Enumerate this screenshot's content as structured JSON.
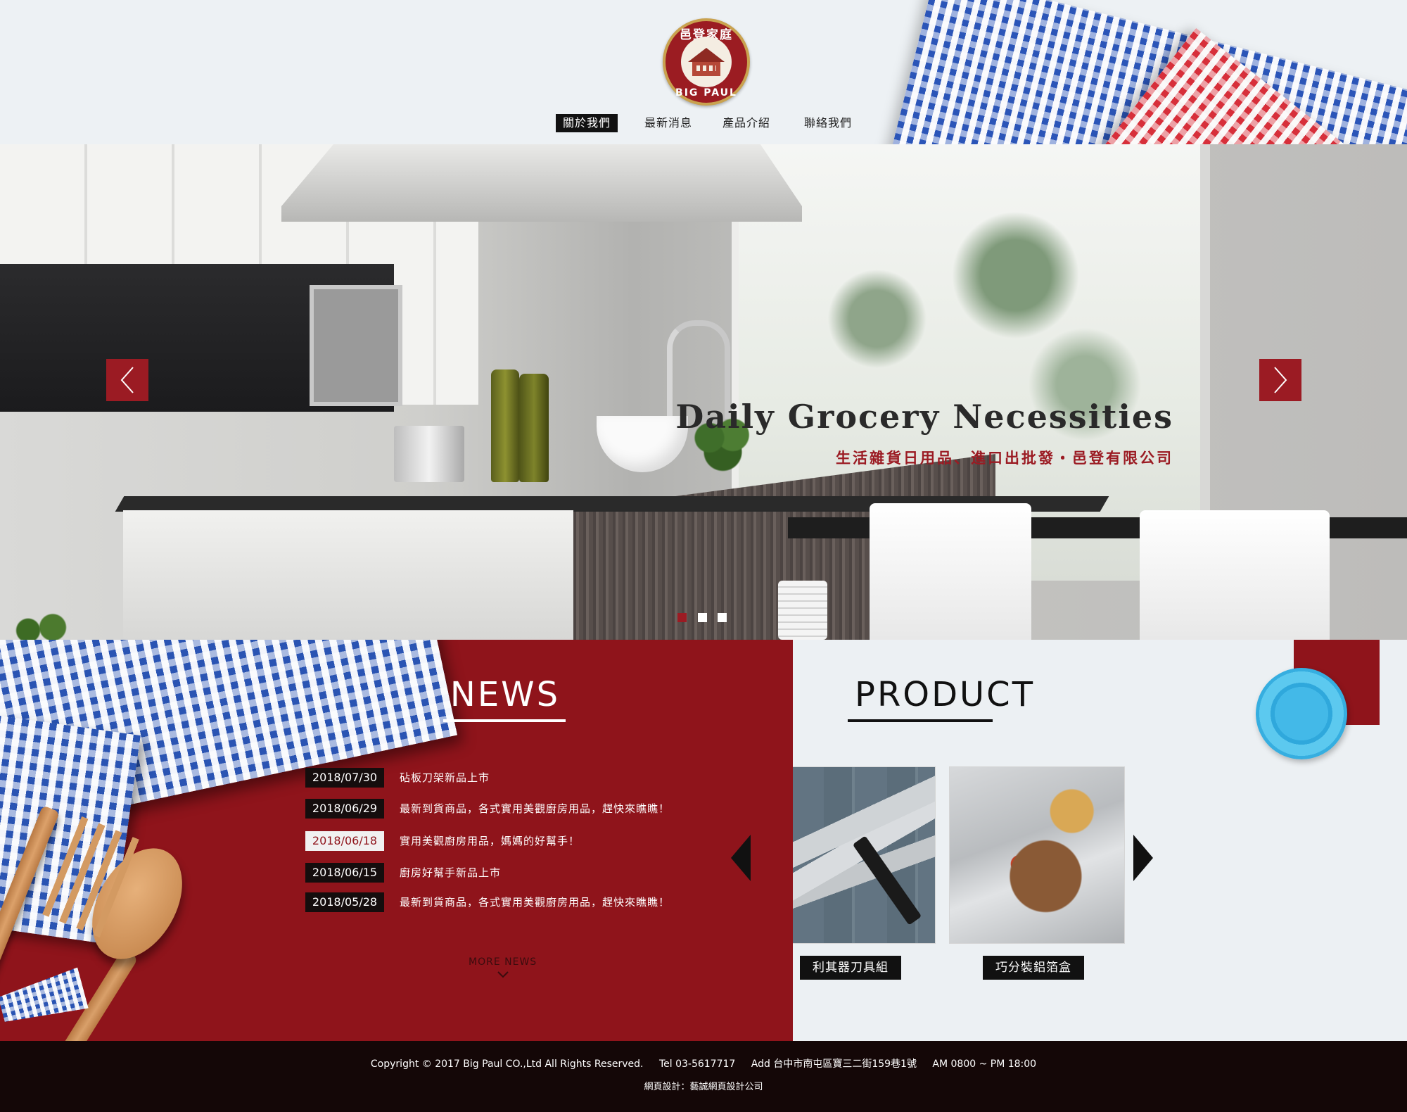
{
  "logo": {
    "cn": "邑登家庭",
    "en": "BIG PAUL"
  },
  "nav": {
    "items": [
      {
        "label": "關於我們",
        "active": true
      },
      {
        "label": "最新消息",
        "active": false
      },
      {
        "label": "產品介紹",
        "active": false
      },
      {
        "label": "聯絡我們",
        "active": false
      }
    ]
  },
  "hero": {
    "title": "Daily Grocery Necessities",
    "subtitle": "生活雜貨日用品、進口出批發・邑登有限公司",
    "arrow_left_icon": "chevron-left-icon",
    "arrow_right_icon": "chevron-right-icon",
    "slides_total": 3,
    "active_slide": 1
  },
  "news": {
    "title": "NEWS",
    "items": [
      {
        "date": "2018/07/30",
        "text": "砧板刀架新品上市",
        "highlight": false
      },
      {
        "date": "2018/06/29",
        "text": "最新到貨商品，各式實用美觀廚房用品，趕快來瞧瞧！",
        "highlight": false
      },
      {
        "date": "2018/06/18",
        "text": "實用美觀廚房用品，媽媽的好幫手！",
        "highlight": true
      },
      {
        "date": "2018/06/15",
        "text": "廚房好幫手新品上市",
        "highlight": false
      },
      {
        "date": "2018/05/28",
        "text": "最新到貨商品，各式實用美觀廚房用品，趕快來瞧瞧！",
        "highlight": false
      }
    ],
    "more_label": "MORE NEWS"
  },
  "product": {
    "title": "PRODUCT",
    "items": [
      {
        "label": "利其器刀具組"
      },
      {
        "label": "巧分裝鋁箔盒"
      }
    ]
  },
  "footer": {
    "copyright": "Copyright © 2017  Big Paul CO.,Ltd All Rights Reserved.",
    "tel": "Tel  03-5617717",
    "address": "Add  台中市南屯區寶三二街159巷1號",
    "hours": "AM  0800 ~ PM 18:00",
    "design": "網頁設計：藝誠網頁設計公司"
  },
  "colors": {
    "brand_red": "#8f141b",
    "dark": "#140707",
    "background": "#ecf0f3"
  }
}
